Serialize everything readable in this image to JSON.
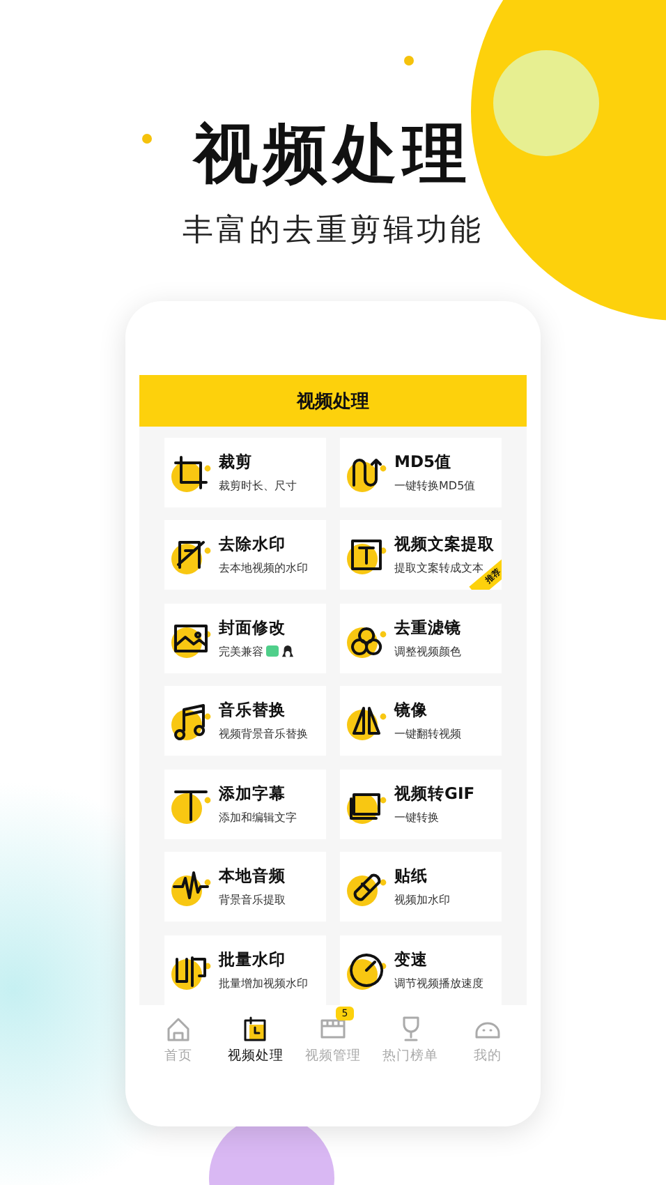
{
  "headline": "视频处理",
  "subtitle": "丰富的去重剪辑功能",
  "screen": {
    "title": "视频处理",
    "tools": [
      {
        "name": "裁剪",
        "desc": "裁剪时长、尺寸"
      },
      {
        "name": "MD5值",
        "desc": "一键转换MD5值"
      },
      {
        "name": "去除水印",
        "desc": "去本地视频的水印"
      },
      {
        "name": "视频文案提取",
        "desc": "提取文案转成文本",
        "ribbon": "推荐"
      },
      {
        "name": "封面修改",
        "desc": "完美兼容"
      },
      {
        "name": "去重滤镜",
        "desc": "调整视频颜色"
      },
      {
        "name": "音乐替换",
        "desc": "视频背景音乐替换"
      },
      {
        "name": "镜像",
        "desc": "一键翻转视频"
      },
      {
        "name": "添加字幕",
        "desc": "添加和编辑文字"
      },
      {
        "name": "视频转GIF",
        "desc": "一键转换"
      },
      {
        "name": "本地音频",
        "desc": "背景音乐提取"
      },
      {
        "name": "贴纸",
        "desc": "视频加水印"
      },
      {
        "name": "批量水印",
        "desc": "批量增加视频水印"
      },
      {
        "name": "变速",
        "desc": "调节视频播放速度"
      }
    ],
    "nav": [
      {
        "label": "首页",
        "selected": false
      },
      {
        "label": "视频处理",
        "selected": true
      },
      {
        "label": "视频管理",
        "selected": false,
        "badge": "5"
      },
      {
        "label": "热门榜单",
        "selected": false
      },
      {
        "label": "我的",
        "selected": false
      }
    ]
  }
}
